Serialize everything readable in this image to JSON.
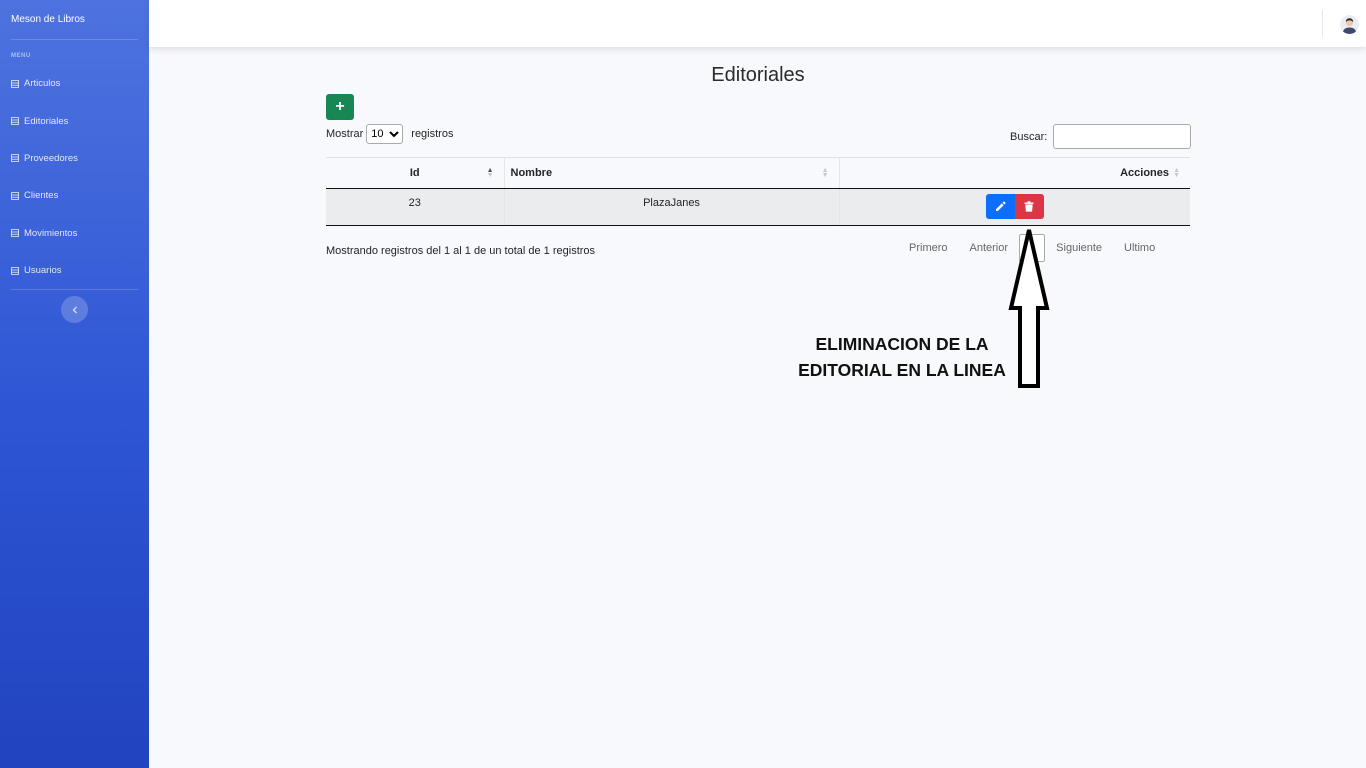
{
  "sidebar": {
    "brand": "Meson de Libros",
    "heading": "MENU",
    "items": [
      {
        "label": "Articulos"
      },
      {
        "label": "Editoriales"
      },
      {
        "label": "Proveedores"
      },
      {
        "label": "Clientes"
      },
      {
        "label": "Movimientos"
      },
      {
        "label": "Usuarios"
      }
    ],
    "toggle_icon": "chevron-left-icon"
  },
  "page": {
    "title": "Editoriales",
    "add_button": "+",
    "length_prefix": "Mostrar",
    "length_value": "10",
    "length_suffix": "registros",
    "search_label": "Buscar:",
    "search_value": ""
  },
  "table": {
    "columns": [
      "Id",
      "Nombre",
      "Acciones"
    ],
    "rows": [
      {
        "id": "23",
        "nombre": "PlazaJanes"
      }
    ]
  },
  "footer": {
    "info": "Mostrando registros del 1 al 1 de un total de 1 registros",
    "pager": {
      "first": "Primero",
      "prev": "Anterior",
      "current": "1",
      "next": "Siguiente",
      "last": "Ultimo"
    }
  },
  "annotation": {
    "line1": "ELIMINACION DE LA",
    "line2": "EDITORIAL EN LA LINEA"
  },
  "colors": {
    "sidebar": "#4e73df",
    "add": "#198754",
    "edit": "#0d6efd",
    "delete": "#dc3545"
  }
}
